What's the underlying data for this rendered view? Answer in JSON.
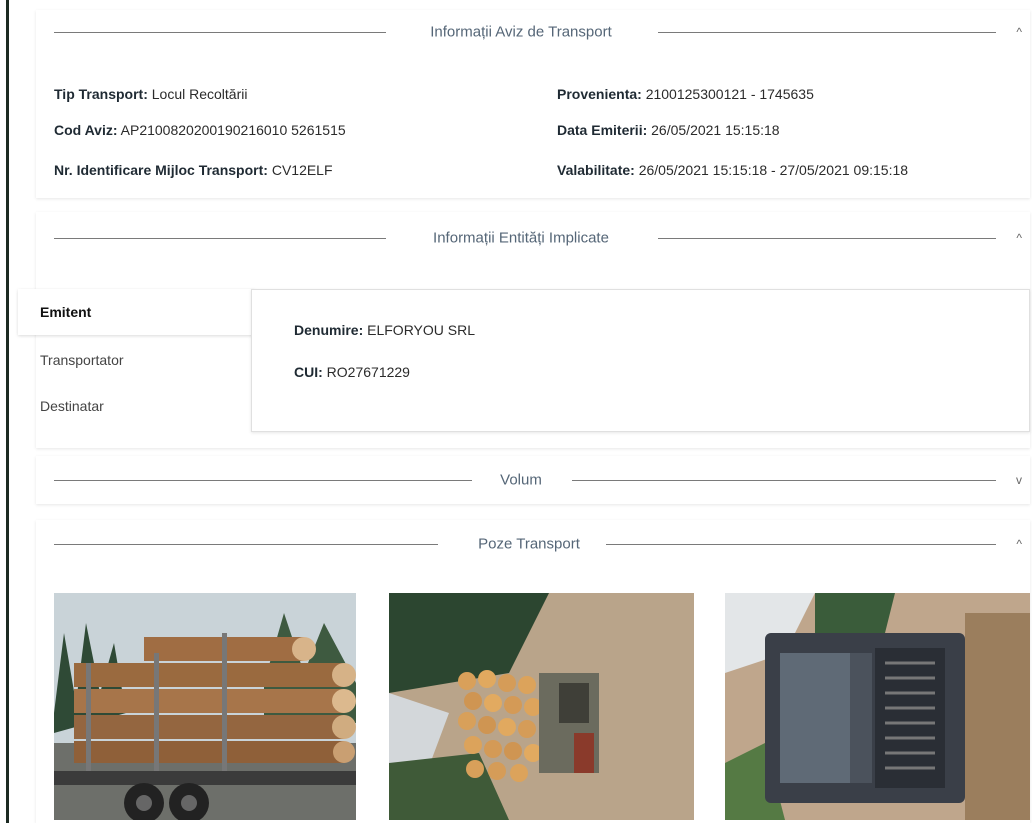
{
  "sections": {
    "aviz": {
      "title": "Informații Aviz de Transport",
      "chevron": "^"
    },
    "entitati": {
      "title": "Informații Entități Implicate",
      "chevron": "^"
    },
    "volum": {
      "title": "Volum",
      "chevron": "v"
    },
    "poze": {
      "title": "Poze Transport",
      "chevron": "^"
    }
  },
  "aviz": {
    "tip_transport": {
      "label": "Tip Transport:",
      "value": "Locul Recoltării"
    },
    "cod_aviz": {
      "label": "Cod Aviz:",
      "value": "AP2100820200190216010 5261515"
    },
    "nr_identificare": {
      "label": "Nr. Identificare Mijloc Transport:",
      "value": "CV12ELF"
    },
    "provenienta": {
      "label": "Provenienta:",
      "value": "2100125300121 - 1745635"
    },
    "data_emiterii": {
      "label": "Data Emiterii:",
      "value": "26/05/2021 15:15:18"
    },
    "valabilitate": {
      "label": "Valabilitate:",
      "value": "26/05/2021 15:15:18 - 27/05/2021 09:15:18"
    }
  },
  "entitati": {
    "tabs": [
      "Emitent",
      "Transportator",
      "Destinatar"
    ],
    "active_tab": "Emitent",
    "denumire": {
      "label": "Denumire:",
      "value": "ELFORYOU SRL"
    },
    "cui": {
      "label": "CUI:",
      "value": "RO27671229"
    }
  },
  "photos": [
    {
      "icon": "log-truck-photo"
    },
    {
      "icon": "log-trailer-photo"
    },
    {
      "icon": "truck-cab-photo"
    }
  ],
  "colors": {
    "header_text": "#556677",
    "line": "#7a7a7a",
    "label": "#1f2a33"
  }
}
